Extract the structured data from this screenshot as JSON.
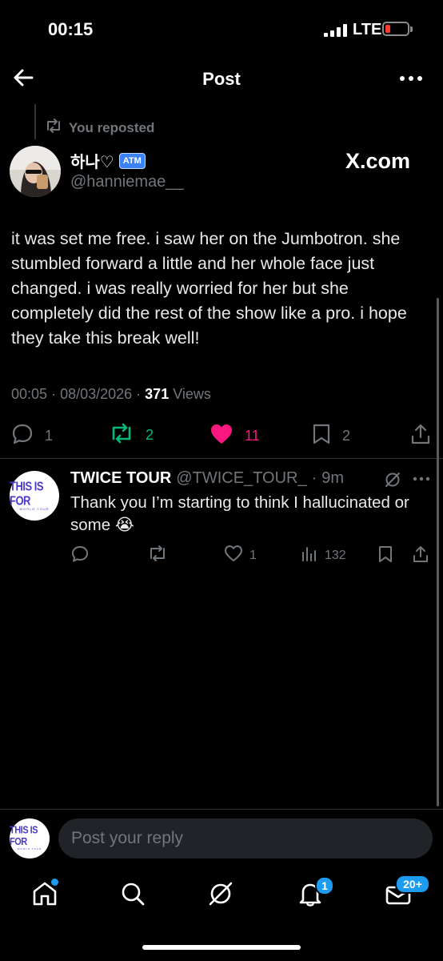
{
  "status": {
    "time": "00:15",
    "network": "LTE"
  },
  "header": {
    "title": "Post"
  },
  "repost": {
    "label": "You reposted"
  },
  "author": {
    "display_name": "하나♡",
    "badge": "ATM",
    "handle": "@hanniemae__",
    "watermark": "X.com"
  },
  "post": {
    "text": "it was set me free. i saw her on the Jumbotron. she stumbled forward a little and her whole face just changed. i was really worried for her but she completely did the rest of the show like a pro. i hope they take this break well!",
    "time": "00:05",
    "date": "08/03/2026",
    "views_count": "371",
    "views_label": "Views"
  },
  "actions": {
    "replies": "1",
    "reposts": "2",
    "likes": "11",
    "bookmarks": "2"
  },
  "reply": {
    "name": "TWICE TOUR",
    "handle": "@TWICE_TOUR_",
    "age": "9m",
    "avatar_text": "THIS IS FOR",
    "avatar_subtext": "WORLD TOUR",
    "text": "Thank you I’m starting to think I hallucinated or some 😭",
    "likes": "1",
    "views": "132"
  },
  "composer": {
    "placeholder": "Post your reply"
  },
  "tabbar": {
    "notifications_badge": "1",
    "messages_badge": "20+"
  },
  "colors": {
    "repost_green": "#00ba7c",
    "like_pink": "#f91880",
    "accent_blue": "#1d9bf0"
  }
}
